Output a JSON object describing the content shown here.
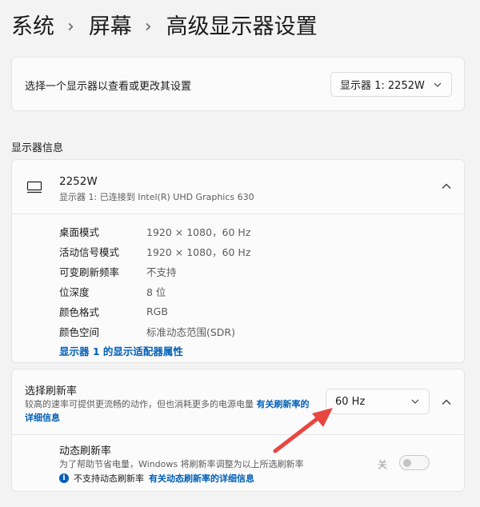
{
  "breadcrumb": {
    "items": [
      "系统",
      "屏幕",
      "高级显示器设置"
    ],
    "separator": "›"
  },
  "display_select": {
    "label": "选择一个显示器以查看或更改其设置",
    "value": "显示器 1: 2252W"
  },
  "display_info": {
    "section_title": "显示器信息",
    "device_name": "2252W",
    "device_status": "显示器 1: 已连接到 Intel(R) UHD Graphics 630",
    "properties": [
      {
        "key": "桌面模式",
        "value": "1920 × 1080，60 Hz"
      },
      {
        "key": "活动信号模式",
        "value": "1920 × 1080，60 Hz"
      },
      {
        "key": "可变刷新频率",
        "value": "不支持"
      },
      {
        "key": "位深度",
        "value": "8 位"
      },
      {
        "key": "颜色格式",
        "value": "RGB"
      },
      {
        "key": "颜色空间",
        "value": "标准动态范围(SDR)"
      }
    ],
    "adapter_link": "显示器 1 的显示适配器属性"
  },
  "refresh_rate": {
    "title": "选择刷新率",
    "description": "较高的速率可提供更流畅的动作，但也消耗更多的电源电量",
    "details_link": "有关刷新率的详细信息",
    "value": "60 Hz"
  },
  "dynamic_refresh": {
    "title": "动态刷新率",
    "description": "为了帮助节省电量，Windows 将刷新率调整为以上所选刷新率",
    "note": "不支持动态刷新率",
    "note_link": "有关动态刷新率的详细信息",
    "toggle_label": "关",
    "toggle_on": false
  },
  "colors": {
    "accent": "#005fb8",
    "annotation_arrow": "#e8473f"
  },
  "icons": {
    "monitor": "monitor-icon",
    "collapse": "chevron-up-icon",
    "dropdown": "chevron-down-icon",
    "info": "info-icon"
  }
}
